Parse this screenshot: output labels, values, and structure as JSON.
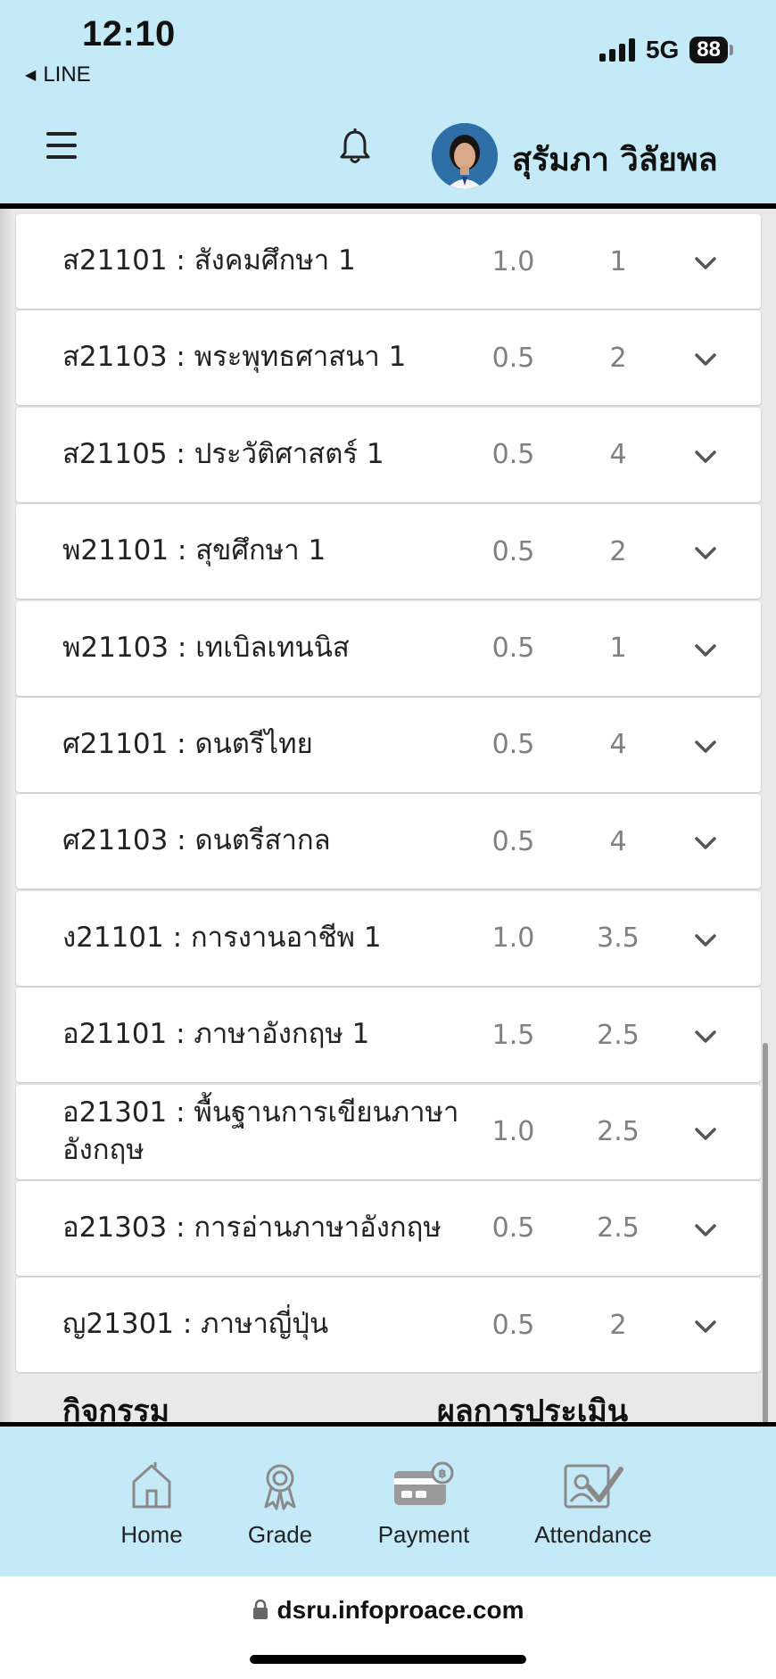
{
  "status_bar": {
    "time": "12:10",
    "back_app": "LINE",
    "network": "5G",
    "battery": "88"
  },
  "header": {
    "user_name": "สุรัมภา วิลัยพล",
    "icons": [
      "menu-icon",
      "bell-icon",
      "avatar"
    ]
  },
  "courses": [
    {
      "name": "ส21101 : สังคมศึกษา 1",
      "credit": "1.0",
      "grade": "1"
    },
    {
      "name": "ส21103 : พระพุทธศาสนา 1",
      "credit": "0.5",
      "grade": "2"
    },
    {
      "name": "ส21105 : ประวัติศาสตร์ 1",
      "credit": "0.5",
      "grade": "4"
    },
    {
      "name": "พ21101 : สุขศึกษา 1",
      "credit": "0.5",
      "grade": "2"
    },
    {
      "name": "พ21103 : เทเบิลเทนนิส",
      "credit": "0.5",
      "grade": "1"
    },
    {
      "name": "ศ21101 : ดนตรีไทย",
      "credit": "0.5",
      "grade": "4"
    },
    {
      "name": "ศ21103 : ดนตรีสากล",
      "credit": "0.5",
      "grade": "4"
    },
    {
      "name": "ง21101 : การงานอาชีพ 1",
      "credit": "1.0",
      "grade": "3.5"
    },
    {
      "name": "อ21101 : ภาษาอังกฤษ 1",
      "credit": "1.5",
      "grade": "2.5"
    },
    {
      "name": "อ21301 : พื้นฐานการเขียนภาษาอังกฤษ",
      "credit": "1.0",
      "grade": "2.5"
    },
    {
      "name": "อ21303 : การอ่านภาษาอังกฤษ",
      "credit": "0.5",
      "grade": "2.5"
    },
    {
      "name": "ญ21301 : ภาษาญี่ปุ่น",
      "credit": "0.5",
      "grade": "2"
    }
  ],
  "activity_header": {
    "col1": "กิจกรรม",
    "col2": "ผลการประเมิน"
  },
  "bottom_nav": [
    {
      "label": "Home",
      "icon": "home-icon"
    },
    {
      "label": "Grade",
      "icon": "award-icon"
    },
    {
      "label": "Payment",
      "icon": "payment-card-icon"
    },
    {
      "label": "Attendance",
      "icon": "attendance-check-icon"
    }
  ],
  "browser": {
    "url": "dsru.infoproace.com"
  },
  "colors": {
    "header_bg": "#c4e9f7",
    "list_bg": "#e9e9e9",
    "muted_text": "#808080"
  }
}
